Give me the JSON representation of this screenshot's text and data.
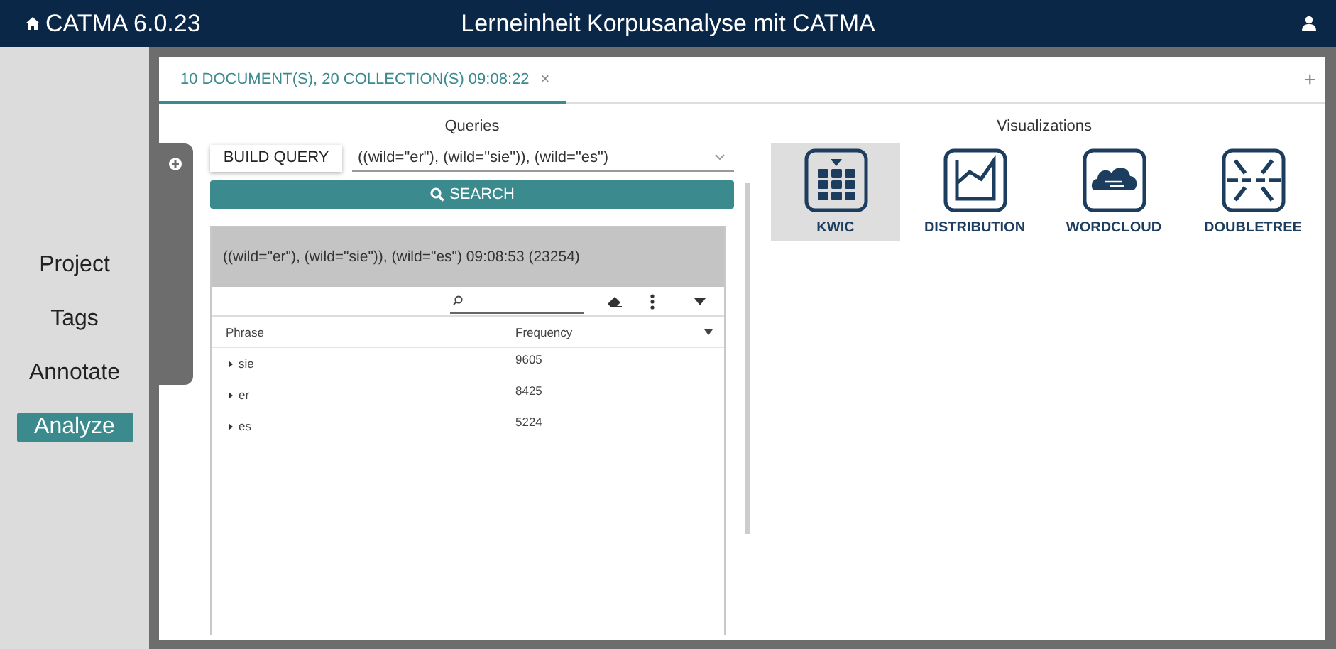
{
  "app": {
    "name": "CATMA 6.0.23",
    "title": "Lerneinheit Korpusanalyse mit CATMA"
  },
  "nav": [
    {
      "label": "Project",
      "selected": false
    },
    {
      "label": "Tags",
      "selected": false
    },
    {
      "label": "Annotate",
      "selected": false
    },
    {
      "label": "Analyze",
      "selected": true
    }
  ],
  "tabs": [
    {
      "label": "10 DOCUMENT(S), 20 COLLECTION(S) 09:08:22",
      "close": "×",
      "selected": true
    }
  ],
  "add_tab": "+",
  "queries": {
    "heading": "Queries",
    "build_button": "BUILD QUERY",
    "query": "((wild=\"er\"), (wild=\"sie\")), (wild=\"es\")",
    "search_button": "SEARCH"
  },
  "result": {
    "title": "((wild=\"er\"), (wild=\"sie\")), (wild=\"es\") 09:08:53 (23254)",
    "columns": [
      "Phrase",
      "Frequency"
    ],
    "rows": [
      {
        "phrase": "sie",
        "frequency": "9605",
        "expanded": false
      },
      {
        "phrase": "er",
        "frequency": "8425",
        "expanded": false
      },
      {
        "phrase": "es",
        "frequency": "5224",
        "expanded": false
      }
    ]
  },
  "visualizations": {
    "heading": "Visualizations",
    "items": [
      {
        "kind": "kwic",
        "label": "KWIC",
        "selected": true
      },
      {
        "kind": "distribution",
        "label": "DISTRIBUTION",
        "selected": false
      },
      {
        "kind": "wordcloud",
        "label": "WORDCLOUD",
        "selected": false
      },
      {
        "kind": "doubletree",
        "label": "DOUBLETREE",
        "selected": false
      }
    ]
  }
}
